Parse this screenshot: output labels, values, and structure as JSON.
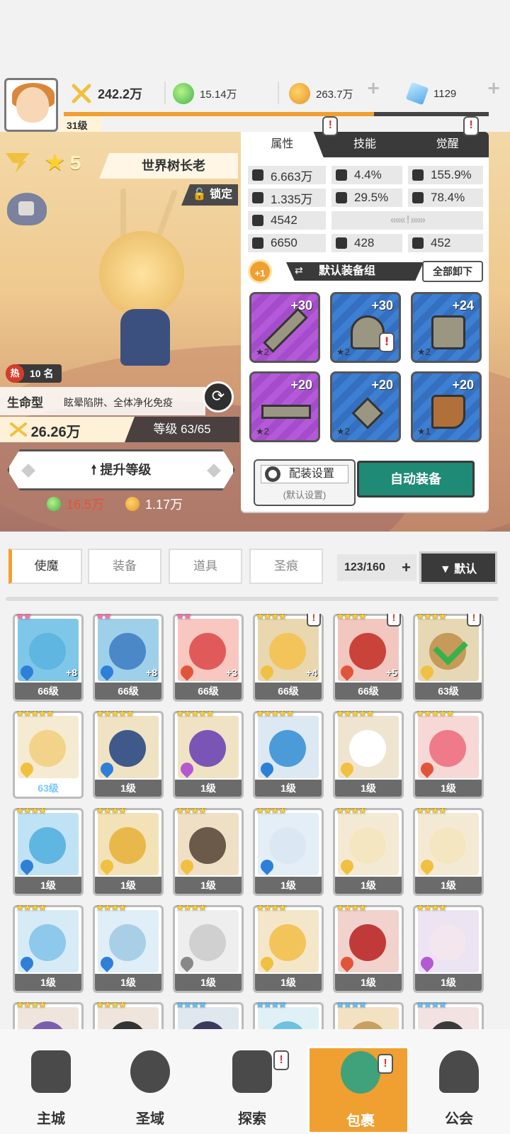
{
  "header": {
    "player_level": "31级",
    "power": "242.2万",
    "green_currency": "15.14万",
    "gold_currency": "263.7万",
    "gems": "1129",
    "plus_icon": "+"
  },
  "hero": {
    "star_level": "5",
    "star_icon": "★",
    "name": "世界树长老",
    "lock_label": "锁定",
    "rank_label": "热",
    "rank": "10 名",
    "type": "生命型",
    "skills_desc": "眩晕陷阱、全体净化免疫",
    "power": "26.26万",
    "level": "等级 63/65",
    "upgrade_label": "提升等级",
    "upgrade_cost_green": "16.5万",
    "upgrade_cost_gold": "1.17万"
  },
  "panel": {
    "tabs": [
      {
        "label": "属性"
      },
      {
        "label": "技能"
      },
      {
        "label": "觉醒"
      }
    ],
    "stats": {
      "hp": "6.663万",
      "crit": "4.4%",
      "crit_dmg": "155.9%",
      "atk": "1.335万",
      "accuracy": "29.5%",
      "dodge": "78.4%",
      "def": "4542",
      "s1": "6650",
      "s2": "428",
      "s3": "452"
    },
    "chevrons": "‹‹‹‹‹‹ ! ››››››",
    "equip_plus": "+1",
    "equip_group": "默认装备组",
    "unload_all": "全部卸下",
    "equipment": [
      {
        "level": "+30",
        "stars": "★2",
        "rarity": "purple"
      },
      {
        "level": "+30",
        "stars": "★2",
        "rarity": "blue"
      },
      {
        "level": "+24",
        "stars": "★2",
        "rarity": "blue"
      },
      {
        "level": "+20",
        "stars": "★2",
        "rarity": "purple"
      },
      {
        "level": "+20",
        "stars": "★2",
        "rarity": "blue"
      },
      {
        "level": "+20",
        "stars": "★1",
        "rarity": "blue"
      }
    ],
    "config_label": "配装设置",
    "config_sub": "(默认设置)",
    "auto_equip": "自动装备"
  },
  "inventory": {
    "tabs": [
      "使魔",
      "装备",
      "道具",
      "圣痕"
    ],
    "count": "123/160",
    "count_plus": "+",
    "sort_label": "▼ 默认",
    "items": [
      {
        "stars": "★★",
        "star_color": "pink",
        "level": "66级",
        "plus": "+8",
        "color": "#7fc7e8",
        "head": "#5fb6e0",
        "elem": "#2e7fd8"
      },
      {
        "stars": "★★",
        "star_color": "pink",
        "level": "66级",
        "plus": "+8",
        "color": "#9fd0ea",
        "head": "#4a88c8",
        "elem": "#2e7fd8"
      },
      {
        "stars": "★★",
        "star_color": "pink",
        "level": "66级",
        "plus": "+3",
        "color": "#f7c7c0",
        "head": "#e05a5a",
        "elem": "#e0553a"
      },
      {
        "stars": "★★★★",
        "star_color": "gold",
        "level": "66级",
        "plus": "+4",
        "color": "#e9d7b0",
        "head": "#f2c45a",
        "elem": "#f0c040",
        "bang": "!"
      },
      {
        "stars": "★★★★",
        "star_color": "gold",
        "level": "66级",
        "plus": "+5",
        "color": "#f2c7c0",
        "head": "#c9433a",
        "elem": "#e0553a",
        "bang": "!"
      },
      {
        "stars": "★★★★",
        "star_color": "gold",
        "level": "63级",
        "plus": "",
        "color": "#e7d8b5",
        "head": "#c69a58",
        "elem": "#f0c040",
        "bang": "!",
        "check": true
      },
      {
        "stars": "★★★★★",
        "star_color": "gold",
        "level": "63级",
        "plus": "",
        "color": "#f5ebd2",
        "head": "#f3d28a",
        "elem": "#f0c040",
        "blue_level": true
      },
      {
        "stars": "★★★★★",
        "star_color": "gold",
        "level": "1级",
        "plus": "",
        "color": "#f0e3c4",
        "head": "#3f5a8a",
        "elem": "#2e7fd8"
      },
      {
        "stars": "★★★★★",
        "star_color": "gold",
        "level": "1级",
        "plus": "",
        "color": "#f0e3c4",
        "head": "#7b55b5",
        "elem": "#b35ad0"
      },
      {
        "stars": "★★★★★",
        "star_color": "gold",
        "level": "1级",
        "plus": "",
        "color": "#dce8f2",
        "head": "#4a9bd8",
        "elem": "#2e7fd8"
      },
      {
        "stars": "★★★★★",
        "star_color": "gold",
        "level": "1级",
        "plus": "",
        "color": "#efe4cf",
        "head": "#ffffff",
        "elem": "#f0c040"
      },
      {
        "stars": "★★★★★",
        "star_color": "gold",
        "level": "1级",
        "plus": "",
        "color": "#f6d8d6",
        "head": "#ef7a8a",
        "elem": "#e0553a"
      },
      {
        "stars": "★★★★",
        "star_color": "gold",
        "level": "1级",
        "plus": "",
        "color": "#bfe2f5",
        "head": "#5fb6e0",
        "elem": "#2e7fd8"
      },
      {
        "stars": "★★★★",
        "star_color": "gold",
        "level": "1级",
        "plus": "",
        "color": "#f3e2b8",
        "head": "#e9b84a",
        "elem": "#f0c040"
      },
      {
        "stars": "★★★★",
        "star_color": "gold",
        "level": "1级",
        "plus": "",
        "color": "#efe0c5",
        "head": "#6b5a4a",
        "elem": "#f0c040"
      },
      {
        "stars": "★★★★",
        "star_color": "gold",
        "level": "1级",
        "plus": "",
        "color": "#e3eef7",
        "head": "#dbe7f3",
        "elem": "#2e7fd8"
      },
      {
        "stars": "★★★★",
        "star_color": "gold",
        "level": "1级",
        "plus": "",
        "color": "#f4ead4",
        "head": "#f5e6c2",
        "elem": "#f0c040"
      },
      {
        "stars": "★★★★",
        "star_color": "gold",
        "level": "1级",
        "plus": "",
        "color": "#f4ead4",
        "head": "#f5e6c2",
        "elem": "#f0c040"
      },
      {
        "stars": "★★★★",
        "star_color": "gold",
        "level": "1级",
        "plus": "",
        "color": "#d7ebf6",
        "head": "#8ec8ea",
        "elem": "#2e7fd8"
      },
      {
        "stars": "★★★★",
        "star_color": "gold",
        "level": "1级",
        "plus": "",
        "color": "#dfeef7",
        "head": "#a9cfe6",
        "elem": "#2e7fd8"
      },
      {
        "stars": "★★★★",
        "star_color": "gold",
        "level": "1级",
        "plus": "",
        "color": "#eeeeee",
        "head": "#d0d0d0",
        "elem": "#888888"
      },
      {
        "stars": "★★★★",
        "star_color": "gold",
        "level": "1级",
        "plus": "",
        "color": "#f4e7c9",
        "head": "#f2c45a",
        "elem": "#f0c040"
      },
      {
        "stars": "★★★★",
        "star_color": "gold",
        "level": "1级",
        "plus": "",
        "color": "#f2d2cc",
        "head": "#c13a3a",
        "elem": "#e0553a"
      },
      {
        "stars": "★★★★",
        "star_color": "gold",
        "level": "1级",
        "plus": "",
        "color": "#ece4f2",
        "head": "#f3e6ee",
        "elem": "#b35ad0"
      },
      {
        "stars": "★★★★",
        "star_color": "gold",
        "level": "",
        "plus": "",
        "color": "#efe5dc",
        "head": "#7a5fb0",
        "elem": ""
      },
      {
        "stars": "★★★★",
        "star_color": "gold",
        "level": "",
        "plus": "",
        "color": "#efe5dc",
        "head": "#333333",
        "elem": ""
      },
      {
        "stars": "★★★★",
        "star_color": "blue",
        "level": "",
        "plus": "",
        "color": "#dfe7ef",
        "head": "#3a3a5a",
        "elem": ""
      },
      {
        "stars": "★★★★",
        "star_color": "blue",
        "level": "",
        "plus": "",
        "color": "#e0f0f7",
        "head": "#6cc2e0",
        "elem": ""
      },
      {
        "stars": "★★★★",
        "star_color": "blue",
        "level": "",
        "plus": "",
        "color": "#f2e2c2",
        "head": "#c8a060",
        "elem": ""
      },
      {
        "stars": "★★★★",
        "star_color": "blue",
        "level": "",
        "plus": "",
        "color": "#f2e2e2",
        "head": "#3a3a3a",
        "elem": ""
      }
    ]
  },
  "nav": [
    {
      "label": "主城"
    },
    {
      "label": "圣域"
    },
    {
      "label": "探索",
      "bang": "!"
    },
    {
      "label": "包裹",
      "bang": "!"
    },
    {
      "label": "公会"
    }
  ],
  "colors": {
    "accent": "#f0a030",
    "auto_equip": "#1f8a76",
    "dark": "#3a3a3a"
  }
}
